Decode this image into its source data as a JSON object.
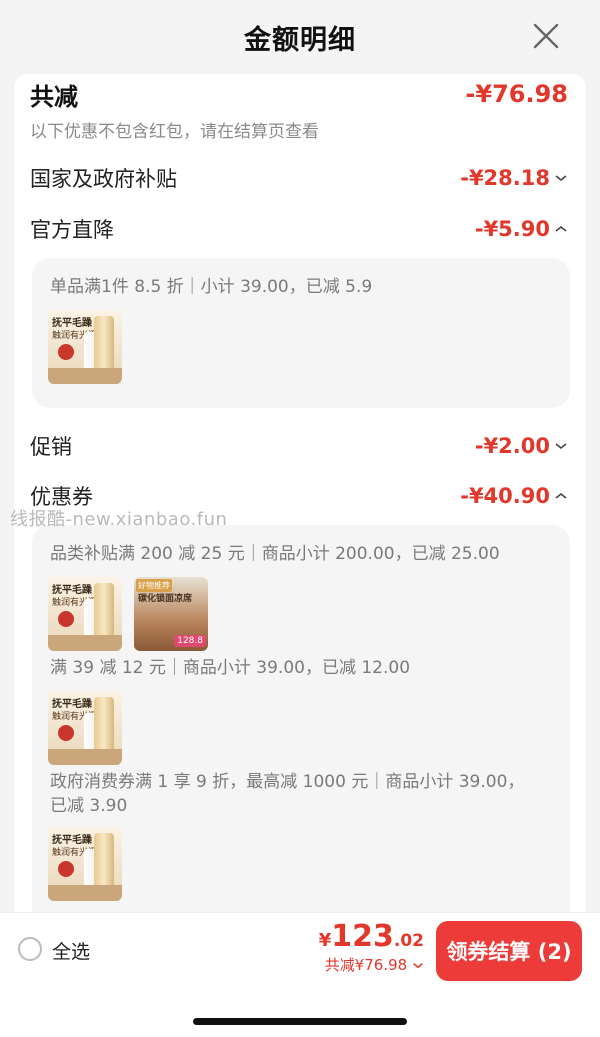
{
  "header": {
    "title": "金额明细"
  },
  "summary": {
    "total_label": "共减",
    "total_amount": "-¥76.98",
    "note": "以下优惠不包含红包，请在结算页查看"
  },
  "rows": {
    "subsidy": {
      "label": "国家及政府补贴",
      "amount": "-¥28.18",
      "expanded": false
    },
    "official": {
      "label": "官方直降",
      "amount": "-¥5.90",
      "expanded": true
    },
    "promo": {
      "label": "促销",
      "amount": "-¥2.00",
      "expanded": false
    },
    "coupon": {
      "label": "优惠券",
      "amount": "-¥40.90",
      "expanded": true
    }
  },
  "official_detail": {
    "text": "单品满1件 8.5 折｜小计 39.00，已减 5.9"
  },
  "coupon_detail": {
    "item1": "品类补贴满 200 减 25 元｜商品小计 200.00，已减 25.00",
    "item2": "满 39 减 12 元｜商品小计 39.00，已减 12.00",
    "item3_line1": "政府消费券满 1 享 9 折，最高减 1000 元｜商品小计 39.00，",
    "item3_line2": "已减 3.90"
  },
  "thumbs": {
    "product_title": "抚平毛躁",
    "product_sub": "触润有光泽",
    "mat_tag": "好物推荐",
    "mat_title": "碳化锁面凉席",
    "mat_price": "128.8"
  },
  "watermark": "线报酷-new.xianbao.fun",
  "bottom": {
    "select_all": "全选",
    "price_yen": "¥",
    "price_int": "123",
    "price_dec": ".02",
    "discount_text": "共减¥76.98",
    "checkout_label": "领券结算 (2)"
  },
  "colors": {
    "accent": "#e2372b",
    "button": "#ec3b38"
  },
  "icons": [
    "close-icon",
    "chevron-down-icon",
    "chevron-up-icon",
    "radio-icon"
  ]
}
